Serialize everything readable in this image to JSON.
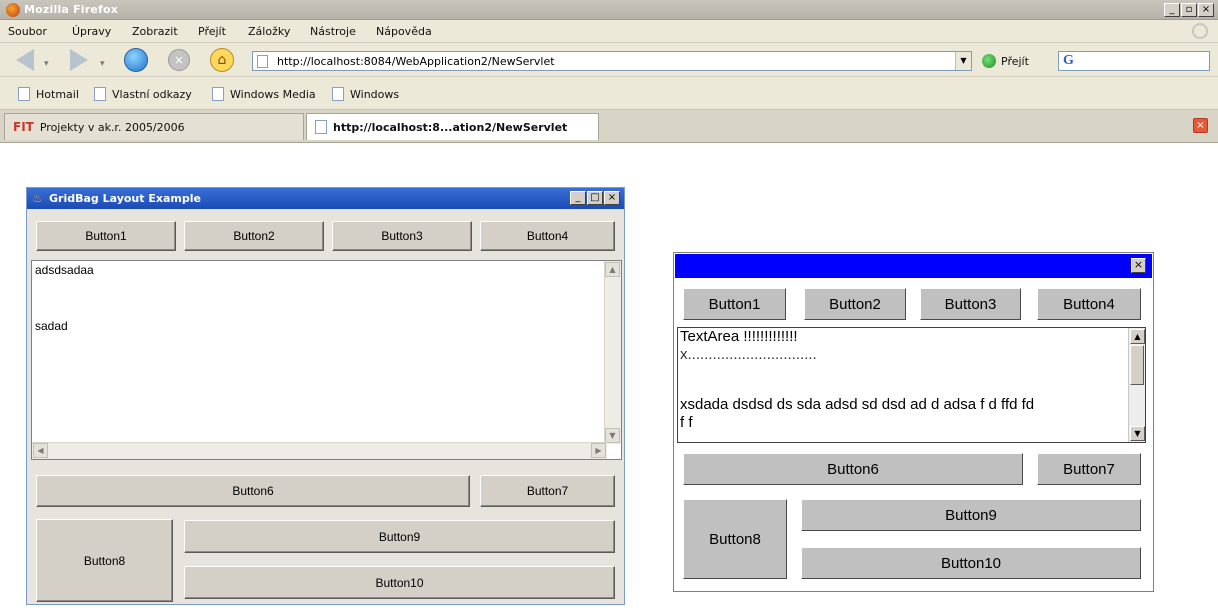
{
  "browser": {
    "title": "Mozilla Firefox",
    "window_buttons": [
      "_",
      "ơ",
      "x"
    ],
    "menu": [
      "Soubor",
      "Úpravy",
      "Zobrazit",
      "Přejít",
      "Záložky",
      "Nástroje",
      "Nápověda"
    ],
    "url": "http://localhost:8084/WebApplication2/NewServlet",
    "go_label": "Přejít",
    "search_logo": "G",
    "bookmarks": [
      "Hotmail",
      "Vlastní odkazy",
      "Windows Media",
      "Windows"
    ],
    "tabs": [
      "Projekty v ak.r. 2005/2006",
      "http://localhost:8...ation2/NewServlet"
    ],
    "tab_icon": "FIT"
  },
  "applet1": {
    "title": "GridBag Layout Example",
    "buttons": {
      "b1": "Button1",
      "b2": "Button2",
      "b3": "Button3",
      "b4": "Button4",
      "b6": "Button6",
      "b7": "Button7",
      "b8": "Button8",
      "b9": "Button9",
      "b10": "Button10"
    },
    "text_lines": [
      "adsdsadaa",
      "",
      "",
      "sadad"
    ]
  },
  "applet2": {
    "close_glyph": "×",
    "buttons": {
      "b1": "Button1",
      "b2": "Button2",
      "b3": "Button3",
      "b4": "Button4",
      "b6": "Button6",
      "b7": "Button7",
      "b8": "Button8",
      "b9": "Button9",
      "b10": "Button10"
    },
    "text_lines": [
      "TextArea !!!!!!!!!!!!!",
      "x...............................",
      "",
      "xsdada dsdsd ds sda adsd sd dsd ad d adsa f d ffd fd",
      "f f"
    ]
  },
  "colors": {
    "applet2_titlebar": "#0000ff",
    "java_titlebar": "#2456c8"
  }
}
